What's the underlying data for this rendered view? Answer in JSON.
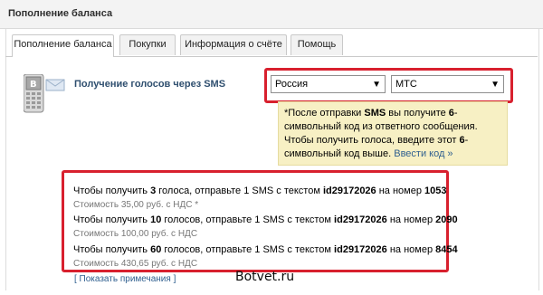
{
  "window": {
    "title": "Пополнение баланса"
  },
  "tabs": [
    {
      "label": "Пополнение баланса",
      "active": true
    },
    {
      "label": "Покупки",
      "active": false
    },
    {
      "label": "Информация о счёте",
      "active": false
    },
    {
      "label": "Помощь",
      "active": false
    }
  ],
  "sms": {
    "title": "Получение голосов через SMS",
    "country": "Россия",
    "operator": "МТС"
  },
  "note": {
    "star": "*",
    "t1": "После отправки ",
    "sms": "SMS",
    "t2": " вы получите ",
    "num": "6",
    "t3": "-символьный код из ответного сообщения.",
    "t4": "Чтобы получить голоса, введите этот ",
    "num2": "6",
    "t5": "-символьный код выше.",
    "link": "Ввести код »"
  },
  "offers": [
    {
      "pre": "Чтобы получить ",
      "votes": "3",
      "mid": " голоса, отправьте 1 SMS с текстом ",
      "code": "id29172026",
      "mid2": " на номер ",
      "number": "1053",
      "cost": "Стоимость 35,00 руб. с НДС *"
    },
    {
      "pre": "Чтобы получить ",
      "votes": "10",
      "mid": " голосов, отправьте 1 SMS с текстом ",
      "code": "id29172026",
      "mid2": " на номер ",
      "number": "2090",
      "cost": "Стоимость 100,00 руб. с НДС"
    },
    {
      "pre": "Чтобы получить ",
      "votes": "60",
      "mid": " голосов, отправьте 1 SMS с текстом ",
      "code": "id29172026",
      "mid2": " на номер ",
      "number": "8454",
      "cost": "Стоимость 430,65 руб. с НДС"
    }
  ],
  "footer": {
    "show_notes": "[ Показать примечания ]",
    "watermark": "Botvet.ru"
  },
  "colors": {
    "highlight": "#d8202e",
    "note_bg": "#f7f0c4",
    "link": "#2f5f8f"
  },
  "icons": {
    "phone": "sms-phone-icon",
    "dropdown": "chevron-down-icon"
  }
}
